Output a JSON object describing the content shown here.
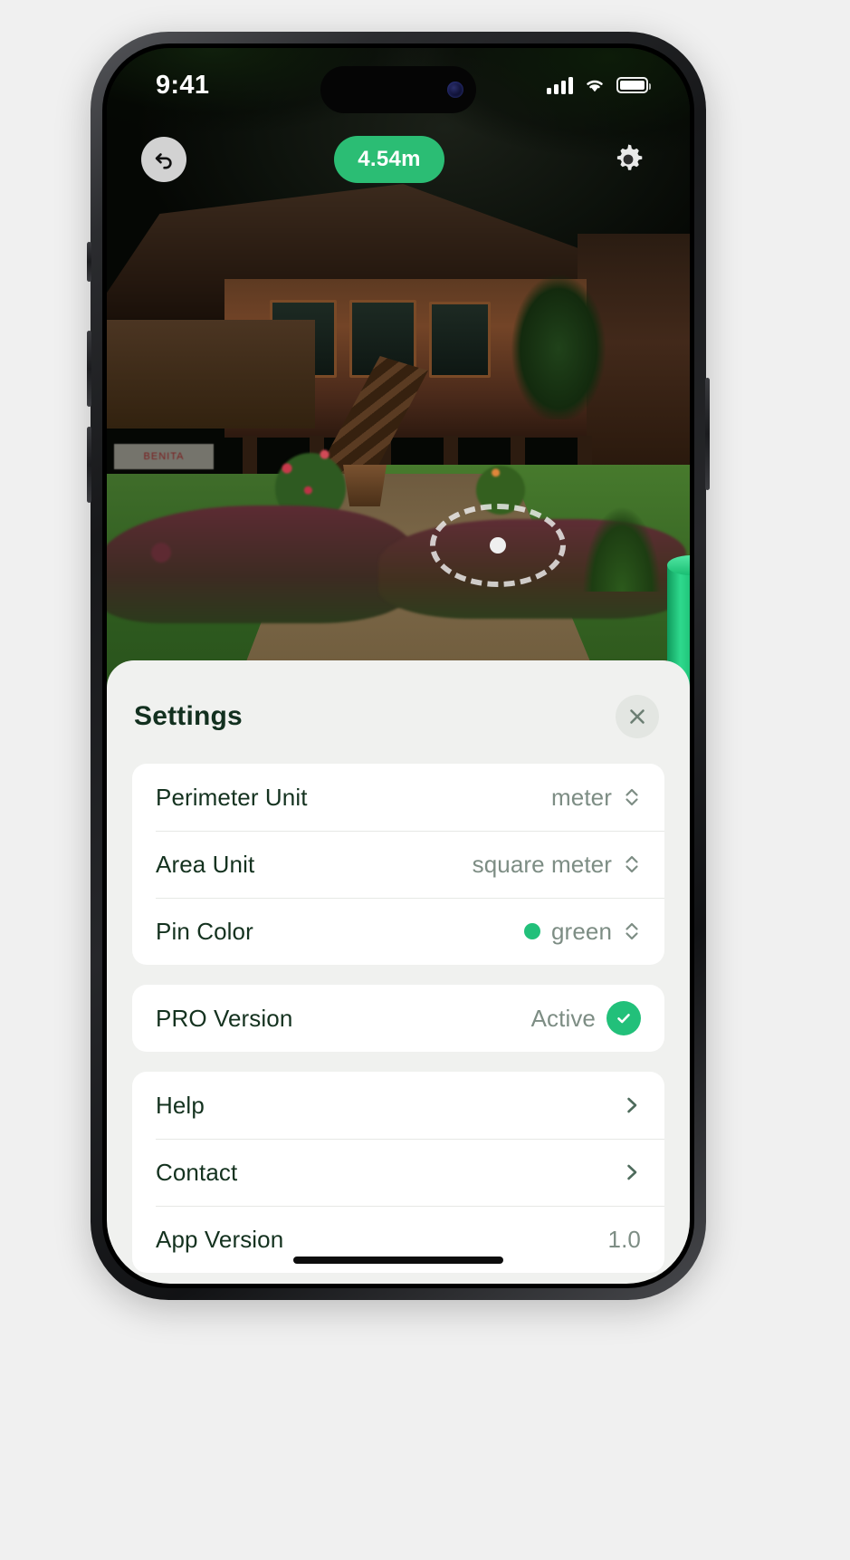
{
  "status_bar": {
    "time": "9:41",
    "cellular_icon": "signal-bars-icon",
    "wifi_icon": "wifi-icon",
    "battery_icon": "battery-icon"
  },
  "ar_view": {
    "undo_icon": "undo-icon",
    "distance_badge": "4.54m",
    "settings_icon": "gear-icon",
    "reticle_icon": "ar-reticle-icon",
    "pin_icon": "ar-pin-marker",
    "scene_sign_text": "BENITA"
  },
  "settings_sheet": {
    "grabber": "sheet-drag-handle",
    "title": "Settings",
    "close_icon": "close-icon",
    "groups": [
      {
        "rows": [
          {
            "label": "Perimeter Unit",
            "value": "meter",
            "control": "stepper",
            "swatch": null
          },
          {
            "label": "Area Unit",
            "value": "square meter",
            "control": "stepper",
            "swatch": null
          },
          {
            "label": "Pin Color",
            "value": "green",
            "control": "stepper",
            "swatch": "#22c07a"
          }
        ]
      },
      {
        "rows": [
          {
            "label": "PRO Version",
            "value": "Active",
            "control": "check",
            "swatch": null
          }
        ]
      },
      {
        "rows": [
          {
            "label": "Help",
            "value": "",
            "control": "chevron",
            "swatch": null
          },
          {
            "label": "Contact",
            "value": "",
            "control": "chevron",
            "swatch": null
          },
          {
            "label": "App Version",
            "value": "1.0",
            "control": "none",
            "swatch": null
          }
        ]
      }
    ]
  },
  "colors": {
    "accent_green": "#22c07a",
    "badge_green": "#2bbd74",
    "sheet_background": "#f0f1ef",
    "card_background": "#ffffff",
    "label_text": "#14321f",
    "value_text": "#7d8d84",
    "grabber": "#adc4b4",
    "page_background": "#f0f0f0"
  }
}
